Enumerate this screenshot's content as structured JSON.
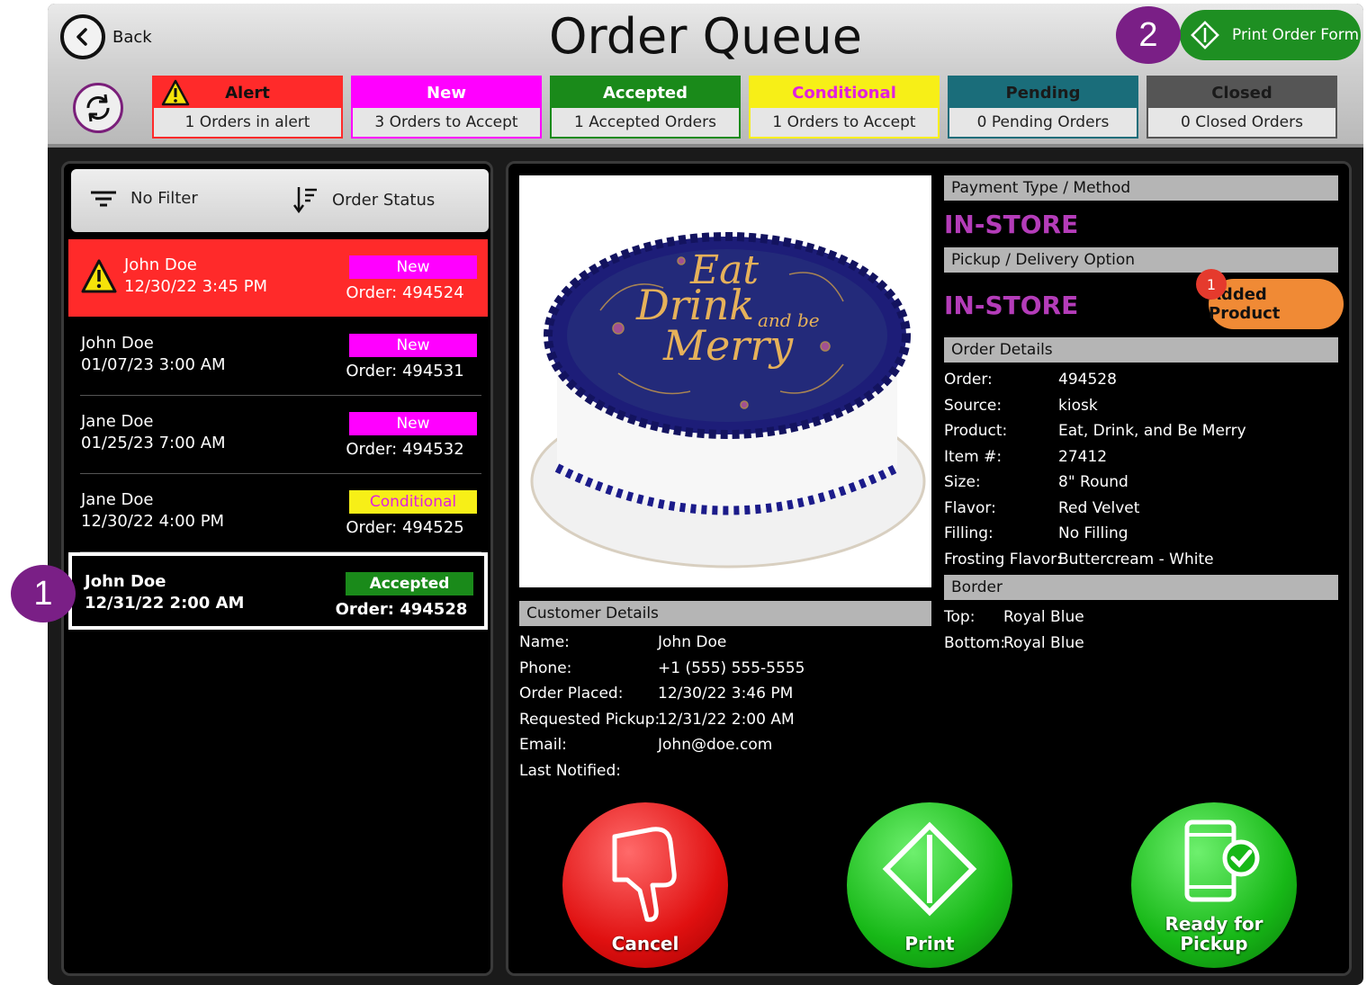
{
  "header": {
    "back_label": "Back",
    "title": "Order Queue",
    "print_order_form_label": "Print Order Form"
  },
  "status_tiles": [
    {
      "label": "Alert",
      "sub": "1 Orders in alert",
      "color": "#ff2a2a",
      "text_color": "#111111"
    },
    {
      "label": "New",
      "sub": "3 Orders to Accept",
      "color": "#ff00ff",
      "text_color": "#ffffff"
    },
    {
      "label": "Accepted",
      "sub": "1 Accepted Orders",
      "color": "#1a8a1a",
      "text_color": "#ffffff"
    },
    {
      "label": "Conditional",
      "sub": "1 Orders to Accept",
      "color": "#f7ef17",
      "text_color": "#e020e0"
    },
    {
      "label": "Pending",
      "sub": "0 Pending Orders",
      "color": "#1a6d7a",
      "text_color": "#1a1a1a"
    },
    {
      "label": "Closed",
      "sub": "0 Closed Orders",
      "color": "#555555",
      "text_color": "#1a1a1a"
    }
  ],
  "filters": {
    "filter_label": "No Filter",
    "sort_label": "Order Status"
  },
  "orders": [
    {
      "name": "John Doe",
      "date": "12/30/22 3:45 PM",
      "status": "New",
      "order": "Order: 494524"
    },
    {
      "name": "John Doe",
      "date": "01/07/23 3:00 AM",
      "status": "New",
      "order": "Order: 494531"
    },
    {
      "name": "Jane Doe",
      "date": "01/25/23 7:00 AM",
      "status": "New",
      "order": "Order: 494532"
    },
    {
      "name": "Jane Doe",
      "date": "12/30/22 4:00 PM",
      "status": "Conditional",
      "order": "Order: 494525"
    },
    {
      "name": "John Doe",
      "date": "12/31/22 2:00 AM",
      "status": "Accepted",
      "order": "Order: 494528"
    }
  ],
  "cake_text": {
    "line1": "Eat",
    "line2": "Drink",
    "line3": "and be",
    "line4": "Merry"
  },
  "customer": {
    "header": "Customer Details",
    "fields": [
      {
        "label": "Name:",
        "value": "John Doe"
      },
      {
        "label": "Phone:",
        "value": "+1 (555) 555-5555"
      },
      {
        "label": "Order Placed:",
        "value": "12/30/22 3:46 PM"
      },
      {
        "label": "Requested Pickup:",
        "value": "12/31/22 2:00 AM"
      },
      {
        "label": "Email:",
        "value": "John@doe.com"
      },
      {
        "label": "Last Notified:",
        "value": ""
      }
    ]
  },
  "payment": {
    "header": "Payment Type / Method",
    "value": "IN-STORE"
  },
  "pickup": {
    "header": "Pickup / Delivery Option",
    "value": "IN-STORE"
  },
  "added_product": {
    "label": "Added Product",
    "count": "1"
  },
  "order_details": {
    "header": "Order Details",
    "fields": [
      {
        "label": "Order:",
        "value": "494528"
      },
      {
        "label": "Source:",
        "value": "kiosk"
      },
      {
        "label": "Product:",
        "value": "Eat, Drink, and Be Merry"
      },
      {
        "label": "Item #:",
        "value": "27412"
      },
      {
        "label": "Size:",
        "value": "8\" Round"
      },
      {
        "label": "Flavor:",
        "value": "Red Velvet"
      },
      {
        "label": "Filling:",
        "value": "No Filling"
      },
      {
        "label": "Frosting Flavor:",
        "value": "Buttercream - White"
      }
    ]
  },
  "border": {
    "header": "Border",
    "fields": [
      {
        "label": "Top:",
        "value": "Royal Blue"
      },
      {
        "label": "Bottom:",
        "value": "Royal Blue"
      }
    ]
  },
  "actions": {
    "cancel": "Cancel",
    "print": "Print",
    "ready_line1": "Ready for",
    "ready_line2": "Pickup"
  },
  "callouts": {
    "one": "1",
    "two": "2"
  }
}
